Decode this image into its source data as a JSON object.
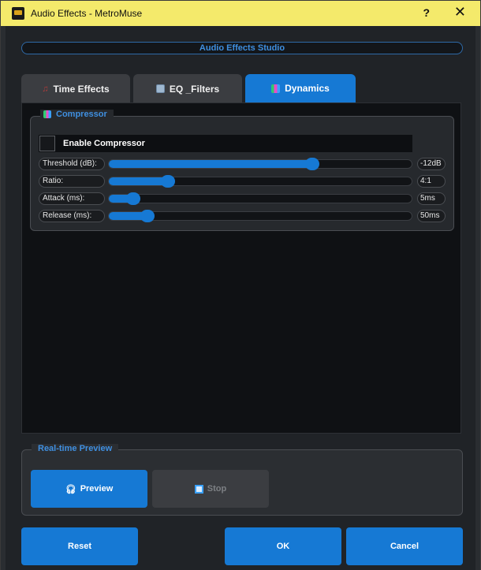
{
  "window": {
    "title": "Audio Effects - MetroMuse",
    "help_label": "?",
    "close_label": "✕"
  },
  "header": {
    "title": "Audio Effects Studio"
  },
  "tabs": [
    {
      "label": "Time Effects",
      "icon": "music-note-icon",
      "active": false
    },
    {
      "label": "EQ _Filters",
      "icon": "equalizer-icon",
      "active": false
    },
    {
      "label": "Dynamics",
      "icon": "dynamics-icon",
      "active": true
    }
  ],
  "compressor": {
    "group_title": "Compressor",
    "enable_label": "Enable Compressor",
    "enabled": false,
    "params": [
      {
        "label": "Threshold (dB):",
        "value": "-12dB",
        "level": 0.68
      },
      {
        "label": "Ratio:",
        "value": "4:1",
        "level": 0.18
      },
      {
        "label": "Attack (ms):",
        "value": "5ms",
        "level": 0.06
      },
      {
        "label": "Release (ms):",
        "value": "50ms",
        "level": 0.11
      }
    ]
  },
  "preview": {
    "group_title": "Real-time Preview",
    "preview_label": "Preview",
    "stop_label": "Stop"
  },
  "footer": {
    "reset_label": "Reset",
    "ok_label": "OK",
    "cancel_label": "Cancel"
  },
  "colors": {
    "accent": "#1679d4",
    "titlebar": "#f4ea6b",
    "group_title": "#3f8fe0"
  }
}
